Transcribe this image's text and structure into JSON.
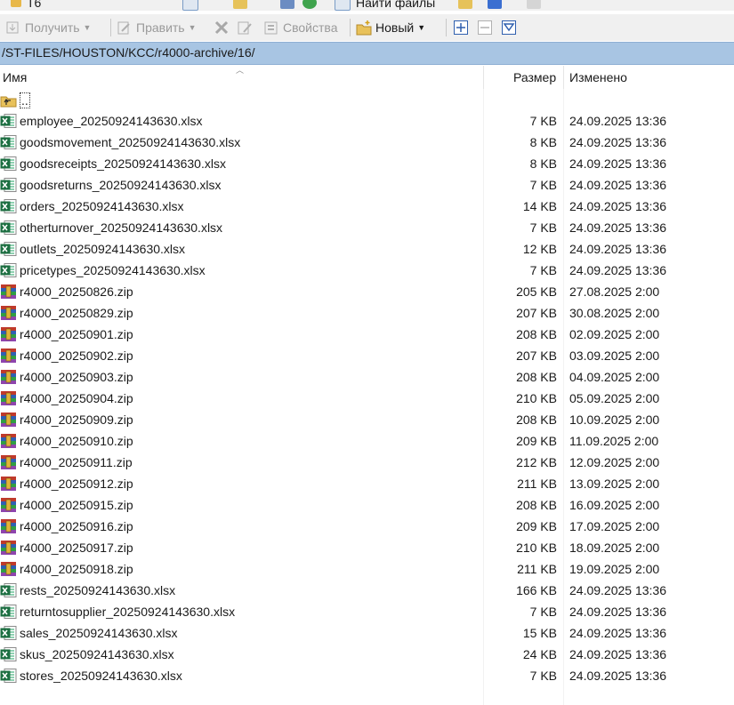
{
  "toolbar_top": {
    "drive_label": "T6",
    "find_files_label": "Найти файлы"
  },
  "toolbar": {
    "get_label": "Получить",
    "edit_label": "Править",
    "properties_label": "Свойства",
    "new_label": "Новый"
  },
  "path": "/ST-FILES/HOUSTON/KCC/r4000-archive/16/",
  "columns": {
    "name": "Имя",
    "size": "Размер",
    "modified": "Изменено"
  },
  "parent_label": "..",
  "files": [
    {
      "name": "employee_20250924143630.xlsx",
      "size": "7 KB",
      "modified": "24.09.2025 13:36",
      "type": "xlsx"
    },
    {
      "name": "goodsmovement_20250924143630.xlsx",
      "size": "8 KB",
      "modified": "24.09.2025 13:36",
      "type": "xlsx"
    },
    {
      "name": "goodsreceipts_20250924143630.xlsx",
      "size": "8 KB",
      "modified": "24.09.2025 13:36",
      "type": "xlsx"
    },
    {
      "name": "goodsreturns_20250924143630.xlsx",
      "size": "7 KB",
      "modified": "24.09.2025 13:36",
      "type": "xlsx"
    },
    {
      "name": "orders_20250924143630.xlsx",
      "size": "14 KB",
      "modified": "24.09.2025 13:36",
      "type": "xlsx"
    },
    {
      "name": "otherturnover_20250924143630.xlsx",
      "size": "7 KB",
      "modified": "24.09.2025 13:36",
      "type": "xlsx"
    },
    {
      "name": "outlets_20250924143630.xlsx",
      "size": "12 KB",
      "modified": "24.09.2025 13:36",
      "type": "xlsx"
    },
    {
      "name": "pricetypes_20250924143630.xlsx",
      "size": "7 KB",
      "modified": "24.09.2025 13:36",
      "type": "xlsx"
    },
    {
      "name": "r4000_20250826.zip",
      "size": "205 KB",
      "modified": "27.08.2025 2:00",
      "type": "zip"
    },
    {
      "name": "r4000_20250829.zip",
      "size": "207 KB",
      "modified": "30.08.2025 2:00",
      "type": "zip"
    },
    {
      "name": "r4000_20250901.zip",
      "size": "208 KB",
      "modified": "02.09.2025 2:00",
      "type": "zip"
    },
    {
      "name": "r4000_20250902.zip",
      "size": "207 KB",
      "modified": "03.09.2025 2:00",
      "type": "zip"
    },
    {
      "name": "r4000_20250903.zip",
      "size": "208 KB",
      "modified": "04.09.2025 2:00",
      "type": "zip"
    },
    {
      "name": "r4000_20250904.zip",
      "size": "210 KB",
      "modified": "05.09.2025 2:00",
      "type": "zip"
    },
    {
      "name": "r4000_20250909.zip",
      "size": "208 KB",
      "modified": "10.09.2025 2:00",
      "type": "zip"
    },
    {
      "name": "r4000_20250910.zip",
      "size": "209 KB",
      "modified": "11.09.2025 2:00",
      "type": "zip"
    },
    {
      "name": "r4000_20250911.zip",
      "size": "212 KB",
      "modified": "12.09.2025 2:00",
      "type": "zip"
    },
    {
      "name": "r4000_20250912.zip",
      "size": "211 KB",
      "modified": "13.09.2025 2:00",
      "type": "zip"
    },
    {
      "name": "r4000_20250915.zip",
      "size": "208 KB",
      "modified": "16.09.2025 2:00",
      "type": "zip"
    },
    {
      "name": "r4000_20250916.zip",
      "size": "209 KB",
      "modified": "17.09.2025 2:00",
      "type": "zip"
    },
    {
      "name": "r4000_20250917.zip",
      "size": "210 KB",
      "modified": "18.09.2025 2:00",
      "type": "zip"
    },
    {
      "name": "r4000_20250918.zip",
      "size": "211 KB",
      "modified": "19.09.2025 2:00",
      "type": "zip"
    },
    {
      "name": "rests_20250924143630.xlsx",
      "size": "166 KB",
      "modified": "24.09.2025 13:36",
      "type": "xlsx"
    },
    {
      "name": "returntosupplier_20250924143630.xlsx",
      "size": "7 KB",
      "modified": "24.09.2025 13:36",
      "type": "xlsx"
    },
    {
      "name": "sales_20250924143630.xlsx",
      "size": "15 KB",
      "modified": "24.09.2025 13:36",
      "type": "xlsx"
    },
    {
      "name": "skus_20250924143630.xlsx",
      "size": "24 KB",
      "modified": "24.09.2025 13:36",
      "type": "xlsx"
    },
    {
      "name": "stores_20250924143630.xlsx",
      "size": "7 KB",
      "modified": "24.09.2025 13:36",
      "type": "xlsx"
    }
  ],
  "colors": {
    "path_bar": "#a8c5e3",
    "excel_green": "#1d6f42",
    "toolbar_bg": "#f0f0f0"
  }
}
